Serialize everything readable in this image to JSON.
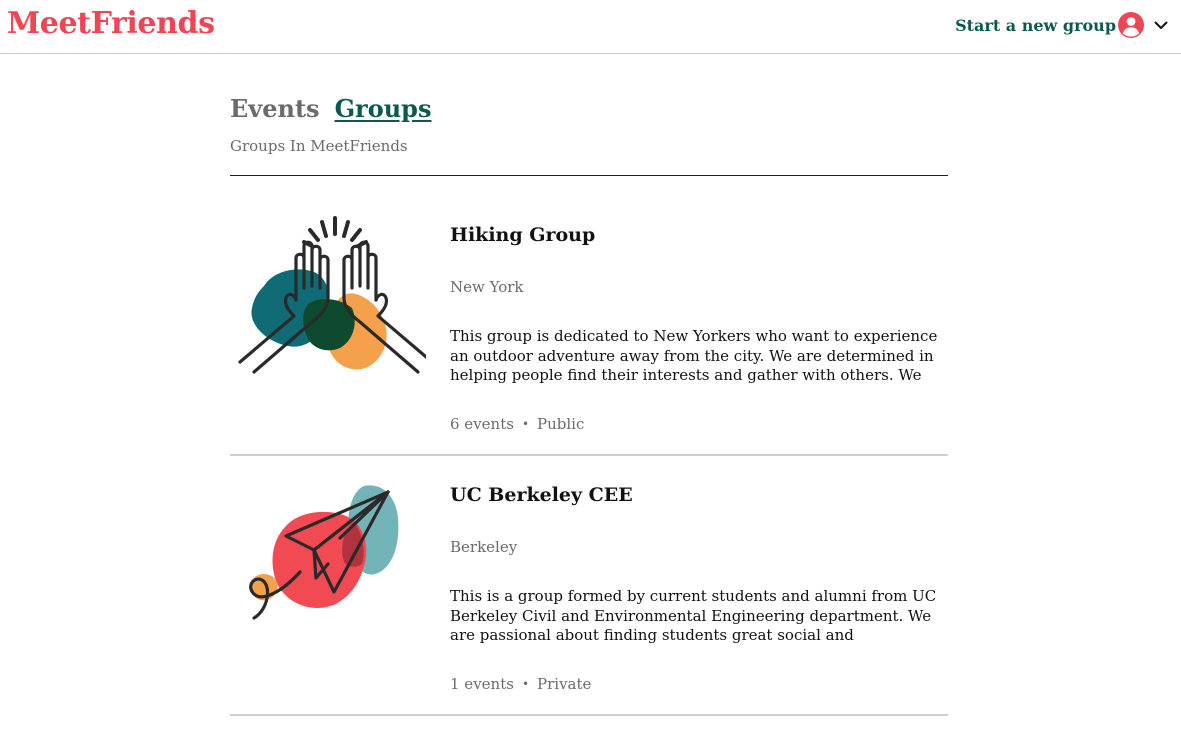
{
  "header": {
    "logo": "MeetFriends",
    "start_group_label": "Start a new group",
    "avatar_icon": "user-circle-icon",
    "menu_icon": "chevron-down-icon",
    "brand_color": "#ef4554",
    "accent_color": "#0c5951"
  },
  "tabs": {
    "events": "Events",
    "groups": "Groups",
    "active": "Groups"
  },
  "subtitle": "Groups In MeetFriends",
  "groups": [
    {
      "name": "Hiking Group",
      "city": "New York",
      "description": "This group is dedicated to New Yorkers who want to experience an outdoor adventure away from the city. We are determined in helping people find their interests and gather with others. We offer lunch,...",
      "events": "6 events",
      "separator": "•",
      "privacy": "Public",
      "image_icon": "high-five-illustration-icon"
    },
    {
      "name": "UC Berkeley CEE",
      "city": "Berkeley",
      "description": "This is a group formed by current students and alumni from UC Berkeley Civil and Environmental Engineering department. We are passional about finding students great social and networking...",
      "events": "1 events",
      "separator": "•",
      "privacy": "Private",
      "image_icon": "paper-plane-illustration-icon"
    }
  ]
}
